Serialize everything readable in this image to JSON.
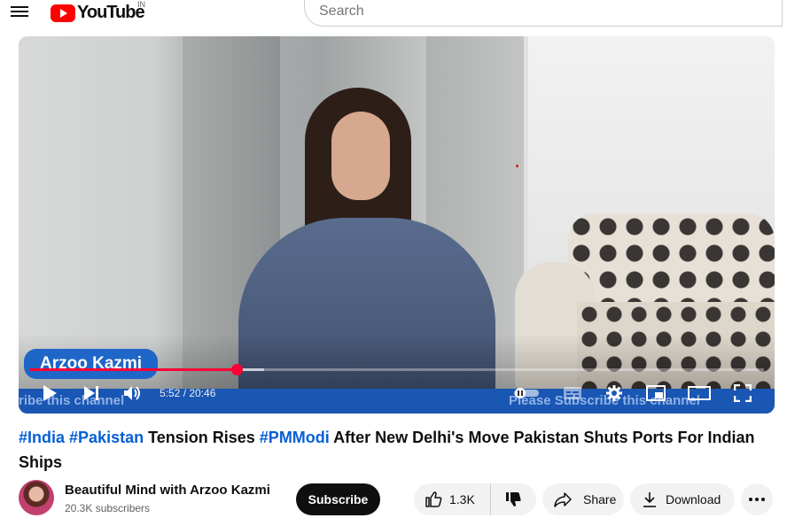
{
  "masthead": {
    "logo_text": "YouTube",
    "region": "IN",
    "search_placeholder": "Search"
  },
  "player": {
    "name_badge": "Arzoo Kazmi",
    "banner_left": "ribe this channel",
    "banner_right": "Please Subscribe this channel",
    "current_time": "5:52",
    "duration": "20:46",
    "time_display": "5:52 / 20:46",
    "progress_fraction": 0.282,
    "buffered_fraction": 0.32
  },
  "video": {
    "title_parts": [
      {
        "text": "#India",
        "tag": true
      },
      {
        "text": " ",
        "tag": false
      },
      {
        "text": "#Pakistan",
        "tag": true
      },
      {
        "text": " Tension Rises ",
        "tag": false
      },
      {
        "text": "#PMModi",
        "tag": true
      },
      {
        "text": " After New Delhi's Move Pakistan Shuts Ports For Indian Ships",
        "tag": false
      }
    ]
  },
  "channel": {
    "name": "Beautiful Mind with Arzoo Kazmi",
    "subscribers": "20.3K subscribers",
    "subscribe_label": "Subscribe"
  },
  "actions": {
    "like_count": "1.3K",
    "share_label": "Share",
    "download_label": "Download"
  },
  "colors": {
    "brand_red": "#ff0000",
    "progress_red": "#ff0033",
    "hashtag_blue": "#065fd4"
  }
}
